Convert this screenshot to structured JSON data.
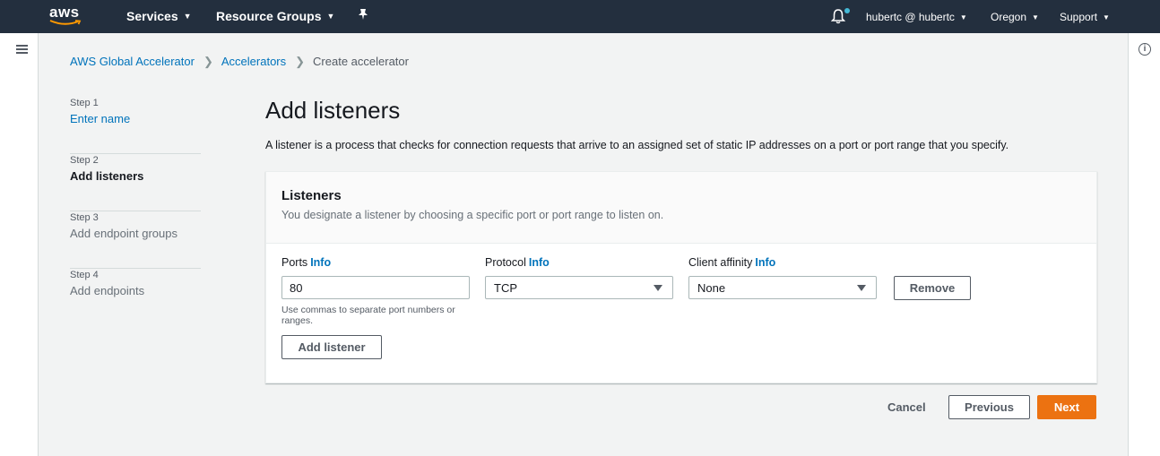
{
  "topnav": {
    "logo_text": "aws",
    "services_label": "Services",
    "resource_groups_label": "Resource Groups",
    "account_label": "hubertc @ hubertc",
    "region_label": "Oregon",
    "support_label": "Support"
  },
  "breadcrumb": {
    "items": [
      "AWS Global Accelerator",
      "Accelerators"
    ],
    "current": "Create accelerator"
  },
  "steps": [
    {
      "num": "Step 1",
      "title": "Enter name"
    },
    {
      "num": "Step 2",
      "title": "Add listeners"
    },
    {
      "num": "Step 3",
      "title": "Add endpoint groups"
    },
    {
      "num": "Step 4",
      "title": "Add endpoints"
    }
  ],
  "page": {
    "title": "Add listeners",
    "description": "A listener is a process that checks for connection requests that arrive to an assigned set of static IP addresses on a port or port range that you specify."
  },
  "listeners": {
    "title": "Listeners",
    "subtitle": "You designate a listener by choosing a specific port or port range to listen on.",
    "ports_label": "Ports",
    "protocol_label": "Protocol",
    "client_affinity_label": "Client affinity",
    "info_label": "Info",
    "ports_value": "80",
    "ports_hint": "Use commas to separate port numbers or ranges.",
    "protocol_value": "TCP",
    "client_affinity_value": "None",
    "remove_label": "Remove",
    "add_listener_label": "Add listener"
  },
  "footer": {
    "cancel_label": "Cancel",
    "previous_label": "Previous",
    "next_label": "Next"
  },
  "colors": {
    "nav_bg": "#232f3e",
    "link": "#0073bb",
    "primary": "#ec7211",
    "notification_dot": "#44b9d6"
  }
}
